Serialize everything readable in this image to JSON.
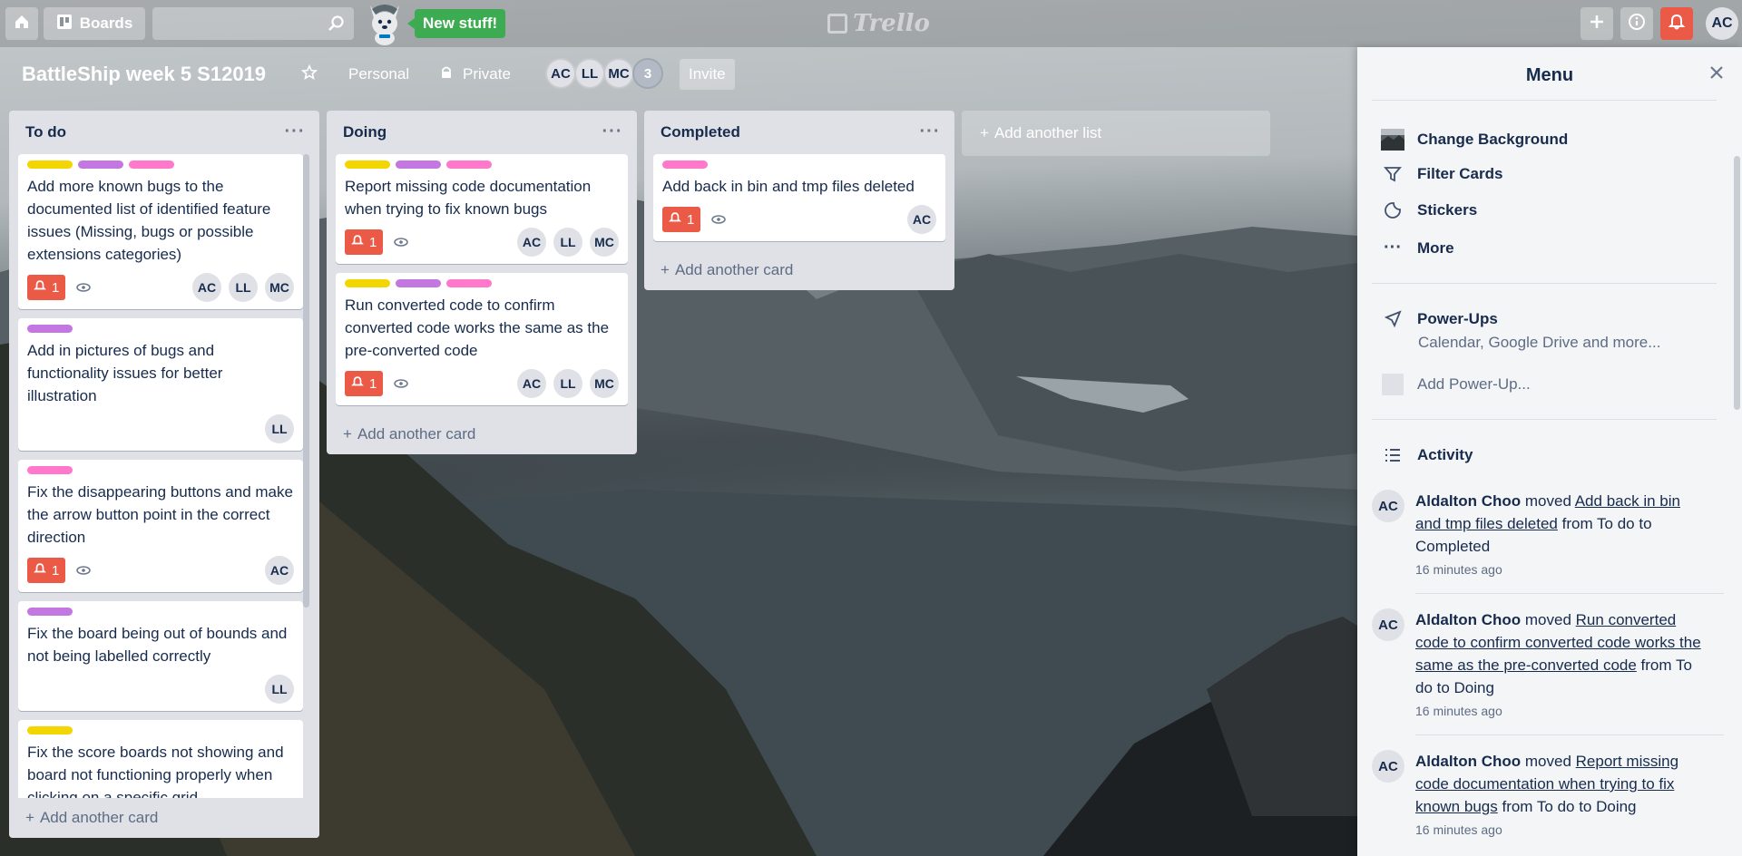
{
  "topbar": {
    "boards_label": "Boards",
    "search_placeholder": "",
    "new_stuff": "New stuff!",
    "logo_text": "Trello",
    "user_initials": "AC",
    "colors": {
      "create": "rgba(255,255,255,0.3)",
      "notifications": "#eb5a46"
    }
  },
  "board": {
    "title": "BattleShip week 5 S12019",
    "team": "Personal",
    "visibility": "Private",
    "members": [
      "AC",
      "LL",
      "MC"
    ],
    "extra_members": "3",
    "invite": "Invite"
  },
  "colors": {
    "yellow": "#f2d600",
    "purple": "#c377e0",
    "pink": "#ff78cb",
    "red": "#eb5a46",
    "green": "#3cab52"
  },
  "lists": [
    {
      "title": "To do",
      "add_card": "Add another card",
      "cards": [
        {
          "labels": [
            "yellow",
            "purple",
            "pink"
          ],
          "title": "Add more known bugs to the documented list of identified feature issues (Missing, bugs or possible extensions categories)",
          "notif": "1",
          "watch": true,
          "members": [
            "AC",
            "LL",
            "MC"
          ]
        },
        {
          "labels": [
            "purple"
          ],
          "title": "Add in pictures of bugs and functionality issues for better illustration",
          "notif": "",
          "watch": false,
          "members": [
            "LL"
          ]
        },
        {
          "labels": [
            "pink"
          ],
          "title": "Fix the disappearing buttons and make the arrow button point in the correct direction",
          "notif": "1",
          "watch": true,
          "members": [
            "AC"
          ]
        },
        {
          "labels": [
            "purple"
          ],
          "title": "Fix the board being out of bounds and not being labelled correctly",
          "notif": "",
          "watch": false,
          "members": [
            "LL"
          ]
        },
        {
          "labels": [
            "yellow"
          ],
          "title": "Fix the score boards not showing and board not functioning properly when clicking on a specific grid",
          "notif": "",
          "watch": false,
          "members": []
        }
      ]
    },
    {
      "title": "Doing",
      "add_card": "Add another card",
      "cards": [
        {
          "labels": [
            "yellow",
            "purple",
            "pink"
          ],
          "title": "Report missing code documentation when trying to fix known bugs",
          "notif": "1",
          "watch": true,
          "members": [
            "AC",
            "LL",
            "MC"
          ]
        },
        {
          "labels": [
            "yellow",
            "purple",
            "pink"
          ],
          "title": "Run converted code to confirm converted code works the same as the pre-converted code",
          "notif": "1",
          "watch": true,
          "members": [
            "AC",
            "LL",
            "MC"
          ]
        }
      ]
    },
    {
      "title": "Completed",
      "add_card": "Add another card",
      "cards": [
        {
          "labels": [
            "pink"
          ],
          "title": "Add back in bin and tmp files deleted",
          "notif": "1",
          "watch": true,
          "members": [
            "AC"
          ]
        }
      ]
    }
  ],
  "add_list": "Add another list",
  "menu": {
    "title": "Menu",
    "items": [
      "Change Background",
      "Filter Cards",
      "Stickers",
      "More"
    ],
    "powerups_title": "Power-Ups",
    "powerups_sub": "Calendar, Google Drive and more...",
    "add_powerup": "Add Power-Up...",
    "activity_title": "Activity",
    "activity": [
      {
        "initials": "AC",
        "user": "Aldalton Choo",
        "verb": "moved",
        "card": "Add back in bin and tmp files deleted",
        "from_to": "from To do to Completed",
        "time": "16 minutes ago"
      },
      {
        "initials": "AC",
        "user": "Aldalton Choo",
        "verb": "moved",
        "card": "Run converted code to confirm converted code works the same as the pre-converted code",
        "from_to": "from To do to Doing",
        "time": "16 minutes ago"
      },
      {
        "initials": "AC",
        "user": "Aldalton Choo",
        "verb": "moved",
        "card": "Report missing code documentation when trying to fix known bugs",
        "from_to": "from To do to Doing",
        "time": "16 minutes ago"
      }
    ]
  }
}
